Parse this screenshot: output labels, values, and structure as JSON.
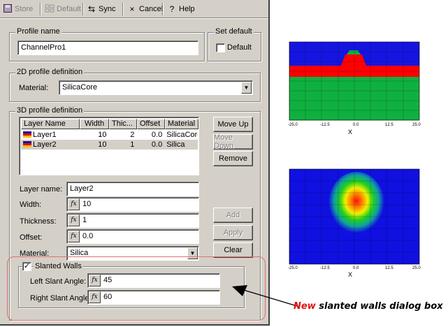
{
  "toolbar": {
    "store": "Store",
    "default": "Default",
    "sync": "Sync",
    "cancel": "Cancel",
    "help": "Help"
  },
  "profile": {
    "name_label": "Profile name",
    "name_value": "ChannelPro1",
    "set_default_label": "Set default",
    "default_checkbox": "Default"
  },
  "profile_2d": {
    "group_label": "2D profile definition",
    "material_label": "Material:",
    "material_value": "SilicaCore"
  },
  "profile_3d": {
    "group_label": "3D profile definition",
    "columns": [
      "Layer Name",
      "Width",
      "Thic...",
      "Offset",
      "Material"
    ],
    "rows": [
      {
        "name": "Layer1",
        "width": "10",
        "thickness": "2",
        "offset": "0.0",
        "material": "SilicaCore"
      },
      {
        "name": "Layer2",
        "width": "10",
        "thickness": "1",
        "offset": "0.0",
        "material": "Silica"
      }
    ],
    "move_up": "Move Up",
    "move_down": "Move Down",
    "remove": "Remove",
    "layer_name_label": "Layer name:",
    "layer_name_value": "Layer2",
    "width_label": "Width:",
    "width_value": "10",
    "thickness_label": "Thickness:",
    "thickness_value": "1",
    "offset_label": "Offset:",
    "offset_value": "0.0",
    "material_label": "Material:",
    "material_value": "Silica",
    "add": "Add",
    "apply": "Apply",
    "clear": "Clear"
  },
  "slanted": {
    "checkbox_label": "Slanted Walls",
    "left_label": "Left Slant Angle:",
    "left_value": "45",
    "right_label": "Right Slant Angle:",
    "right_value": "60"
  },
  "fx_glyph": "fx",
  "annotation": {
    "new_word": "New",
    "rest": "slanted walls dialog box",
    "color_new": "#e01010",
    "box_color": "#e07070"
  },
  "plots": {
    "x_axis_label": "X",
    "x_ticks": [
      "-25.0",
      "-12.5",
      "0.0",
      "12.5",
      "25.0"
    ],
    "profile_colors": {
      "cladding": "#1515e0",
      "core": "#ff0000",
      "substrate": "#10b040",
      "rib": "#10b040"
    },
    "field_background": "#1010e0"
  }
}
